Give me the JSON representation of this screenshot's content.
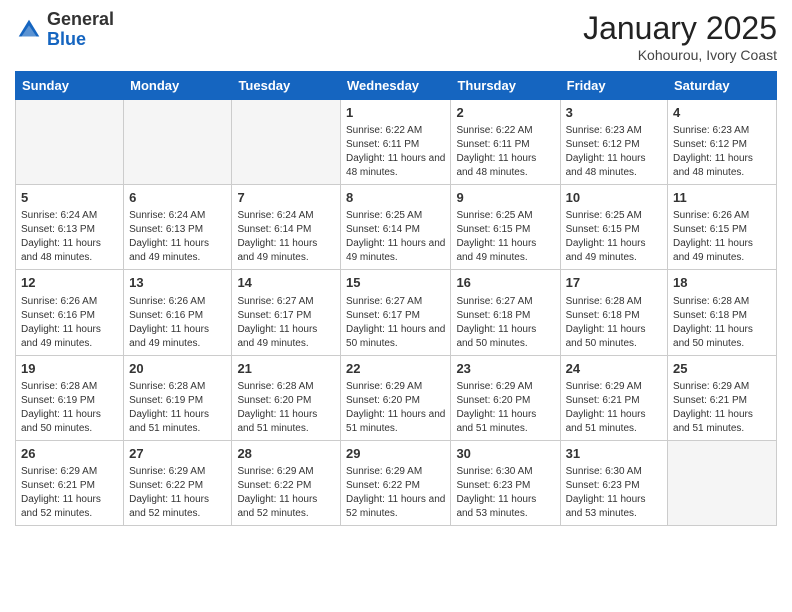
{
  "logo": {
    "general": "General",
    "blue": "Blue"
  },
  "header": {
    "month": "January 2025",
    "location": "Kohourou, Ivory Coast"
  },
  "days_of_week": [
    "Sunday",
    "Monday",
    "Tuesday",
    "Wednesday",
    "Thursday",
    "Friday",
    "Saturday"
  ],
  "weeks": [
    [
      {
        "day": "",
        "empty": true
      },
      {
        "day": "",
        "empty": true
      },
      {
        "day": "",
        "empty": true
      },
      {
        "day": "1",
        "sunrise": "6:22 AM",
        "sunset": "6:11 PM",
        "daylight": "11 hours and 48 minutes."
      },
      {
        "day": "2",
        "sunrise": "6:22 AM",
        "sunset": "6:11 PM",
        "daylight": "11 hours and 48 minutes."
      },
      {
        "day": "3",
        "sunrise": "6:23 AM",
        "sunset": "6:12 PM",
        "daylight": "11 hours and 48 minutes."
      },
      {
        "day": "4",
        "sunrise": "6:23 AM",
        "sunset": "6:12 PM",
        "daylight": "11 hours and 48 minutes."
      }
    ],
    [
      {
        "day": "5",
        "sunrise": "6:24 AM",
        "sunset": "6:13 PM",
        "daylight": "11 hours and 48 minutes."
      },
      {
        "day": "6",
        "sunrise": "6:24 AM",
        "sunset": "6:13 PM",
        "daylight": "11 hours and 49 minutes."
      },
      {
        "day": "7",
        "sunrise": "6:24 AM",
        "sunset": "6:14 PM",
        "daylight": "11 hours and 49 minutes."
      },
      {
        "day": "8",
        "sunrise": "6:25 AM",
        "sunset": "6:14 PM",
        "daylight": "11 hours and 49 minutes."
      },
      {
        "day": "9",
        "sunrise": "6:25 AM",
        "sunset": "6:15 PM",
        "daylight": "11 hours and 49 minutes."
      },
      {
        "day": "10",
        "sunrise": "6:25 AM",
        "sunset": "6:15 PM",
        "daylight": "11 hours and 49 minutes."
      },
      {
        "day": "11",
        "sunrise": "6:26 AM",
        "sunset": "6:15 PM",
        "daylight": "11 hours and 49 minutes."
      }
    ],
    [
      {
        "day": "12",
        "sunrise": "6:26 AM",
        "sunset": "6:16 PM",
        "daylight": "11 hours and 49 minutes."
      },
      {
        "day": "13",
        "sunrise": "6:26 AM",
        "sunset": "6:16 PM",
        "daylight": "11 hours and 49 minutes."
      },
      {
        "day": "14",
        "sunrise": "6:27 AM",
        "sunset": "6:17 PM",
        "daylight": "11 hours and 49 minutes."
      },
      {
        "day": "15",
        "sunrise": "6:27 AM",
        "sunset": "6:17 PM",
        "daylight": "11 hours and 50 minutes."
      },
      {
        "day": "16",
        "sunrise": "6:27 AM",
        "sunset": "6:18 PM",
        "daylight": "11 hours and 50 minutes."
      },
      {
        "day": "17",
        "sunrise": "6:28 AM",
        "sunset": "6:18 PM",
        "daylight": "11 hours and 50 minutes."
      },
      {
        "day": "18",
        "sunrise": "6:28 AM",
        "sunset": "6:18 PM",
        "daylight": "11 hours and 50 minutes."
      }
    ],
    [
      {
        "day": "19",
        "sunrise": "6:28 AM",
        "sunset": "6:19 PM",
        "daylight": "11 hours and 50 minutes."
      },
      {
        "day": "20",
        "sunrise": "6:28 AM",
        "sunset": "6:19 PM",
        "daylight": "11 hours and 51 minutes."
      },
      {
        "day": "21",
        "sunrise": "6:28 AM",
        "sunset": "6:20 PM",
        "daylight": "11 hours and 51 minutes."
      },
      {
        "day": "22",
        "sunrise": "6:29 AM",
        "sunset": "6:20 PM",
        "daylight": "11 hours and 51 minutes."
      },
      {
        "day": "23",
        "sunrise": "6:29 AM",
        "sunset": "6:20 PM",
        "daylight": "11 hours and 51 minutes."
      },
      {
        "day": "24",
        "sunrise": "6:29 AM",
        "sunset": "6:21 PM",
        "daylight": "11 hours and 51 minutes."
      },
      {
        "day": "25",
        "sunrise": "6:29 AM",
        "sunset": "6:21 PM",
        "daylight": "11 hours and 51 minutes."
      }
    ],
    [
      {
        "day": "26",
        "sunrise": "6:29 AM",
        "sunset": "6:21 PM",
        "daylight": "11 hours and 52 minutes."
      },
      {
        "day": "27",
        "sunrise": "6:29 AM",
        "sunset": "6:22 PM",
        "daylight": "11 hours and 52 minutes."
      },
      {
        "day": "28",
        "sunrise": "6:29 AM",
        "sunset": "6:22 PM",
        "daylight": "11 hours and 52 minutes."
      },
      {
        "day": "29",
        "sunrise": "6:29 AM",
        "sunset": "6:22 PM",
        "daylight": "11 hours and 52 minutes."
      },
      {
        "day": "30",
        "sunrise": "6:30 AM",
        "sunset": "6:23 PM",
        "daylight": "11 hours and 53 minutes."
      },
      {
        "day": "31",
        "sunrise": "6:30 AM",
        "sunset": "6:23 PM",
        "daylight": "11 hours and 53 minutes."
      },
      {
        "day": "",
        "empty": true
      }
    ]
  ],
  "labels": {
    "sunrise": "Sunrise:",
    "sunset": "Sunset:",
    "daylight": "Daylight:"
  }
}
